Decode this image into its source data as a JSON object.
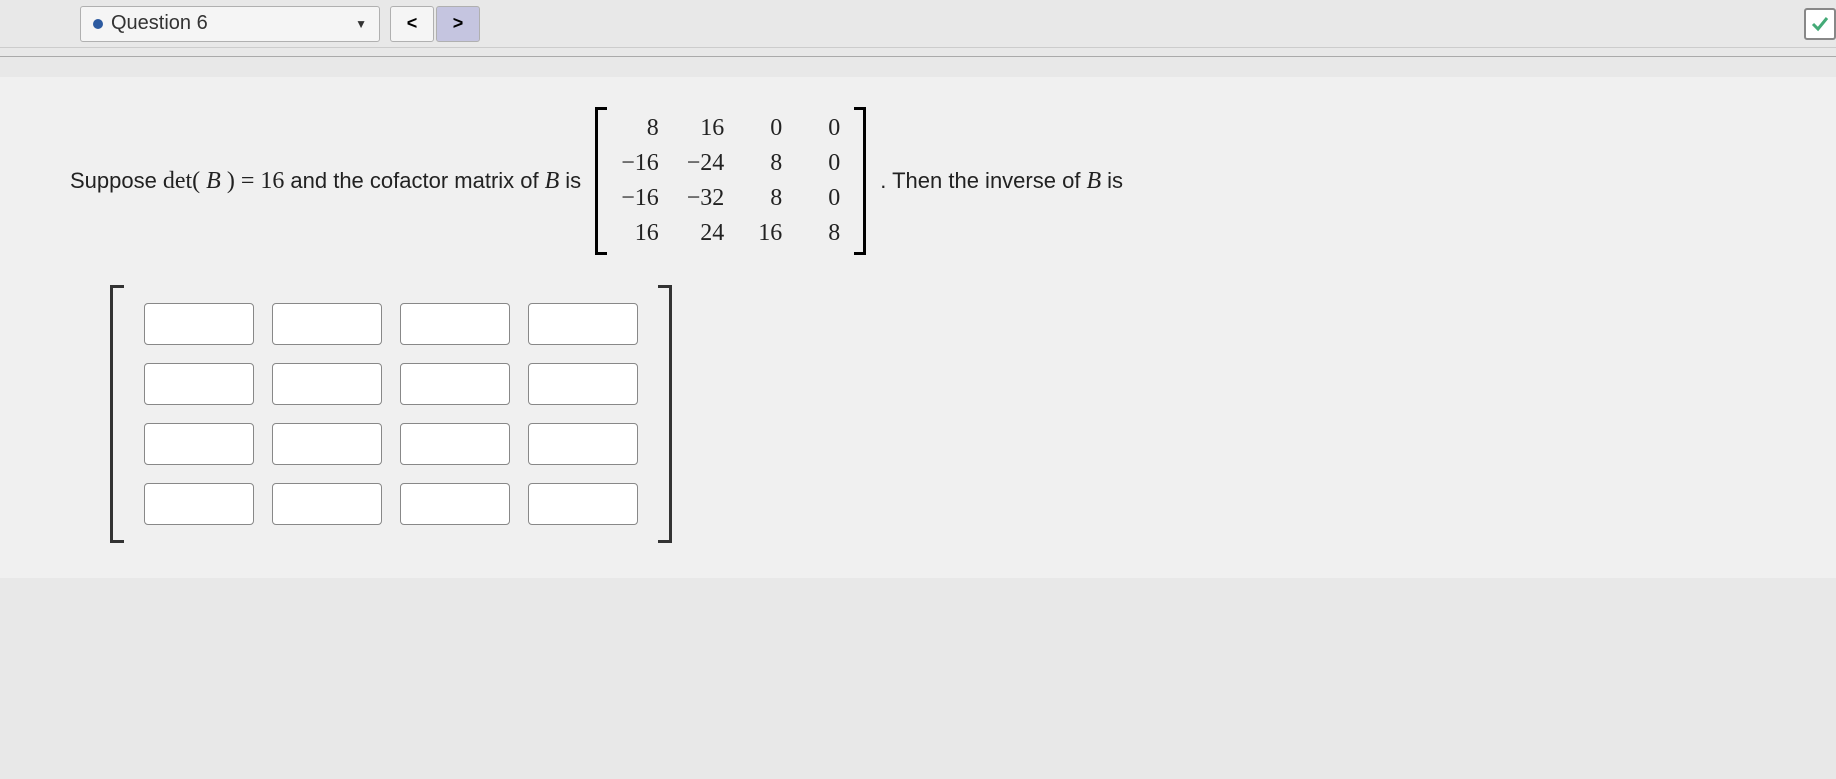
{
  "toolbar": {
    "question_label": "Question 6",
    "prev_icon": "<",
    "next_icon": ">"
  },
  "problem": {
    "text1": "Suppose",
    "det_label": "det(",
    "var_B": "B",
    "close_paren": ")",
    "equals": "=",
    "det_value": "16",
    "text2": "and the cofactor matrix of",
    "text3": "is",
    "text4": ". Then the inverse of",
    "text5": "is"
  },
  "cofactor": {
    "rows": [
      [
        "8",
        "16",
        "0",
        "0"
      ],
      [
        "−16",
        "−24",
        "8",
        "0"
      ],
      [
        "−16",
        "−32",
        "8",
        "0"
      ],
      [
        "16",
        "24",
        "16",
        "8"
      ]
    ]
  },
  "answer": {
    "rows": 4,
    "cols": 4,
    "values": [
      [
        "",
        "",
        "",
        ""
      ],
      [
        "",
        "",
        "",
        ""
      ],
      [
        "",
        "",
        "",
        ""
      ],
      [
        "",
        "",
        "",
        ""
      ]
    ]
  }
}
